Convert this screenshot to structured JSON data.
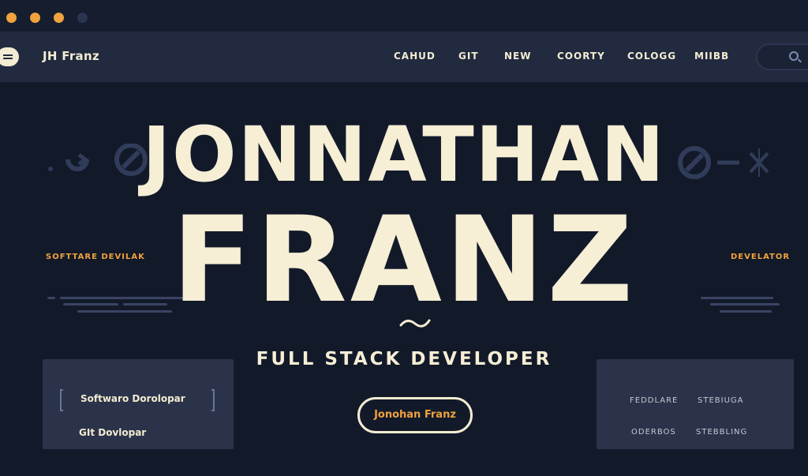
{
  "brand": "JH Franz",
  "nav": {
    "links": [
      "CAHUD",
      "GIT",
      "NEW",
      "COORTY",
      "COLOGG",
      "MIIBB"
    ]
  },
  "hero": {
    "line1": "JONNATHAN",
    "line2": "FRANZ",
    "subtitle": "FULL STACK DEVELOPER"
  },
  "sides": {
    "left_label": "SOFTTARE DEVILAK",
    "right_label": "DEVELATOR"
  },
  "card_left": {
    "item1": "Softwaro Dorolopar",
    "item2": "GIt Dovlopar"
  },
  "card_right": {
    "tags": [
      "FEDDLARE",
      "STEBIUGA",
      "ODERBOS",
      "STEBBLING"
    ]
  },
  "cta": {
    "label": "Jonohan Franz"
  },
  "colors": {
    "background": "#121a2a",
    "navbar": "#212a3f",
    "accent": "#f0a23d",
    "text": "#f6eed5",
    "card": "#2a3349"
  },
  "icons": [
    "menu-icon",
    "search-icon",
    "arrows-loop-icon",
    "no-entry-icon",
    "slash-circle-icon",
    "sparkle-icon",
    "tilde-icon"
  ]
}
